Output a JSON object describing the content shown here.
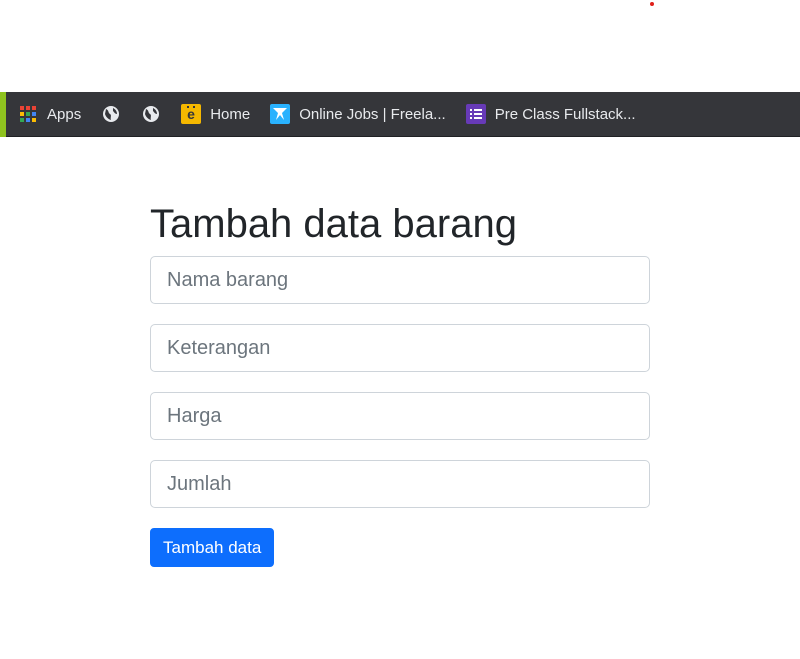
{
  "colors": {
    "bookmark_bar_bg": "#35363a",
    "bookmark_text": "#e8eaed",
    "accent_stripe": "#8fc31f",
    "primary_button": "#0d6efd",
    "input_border": "#ced4da",
    "placeholder": "#6c757d",
    "heading": "#212529"
  },
  "bookmarks": [
    {
      "label": "Apps",
      "icon": "apps-grid-icon"
    },
    {
      "label": "",
      "icon": "globe-icon"
    },
    {
      "label": "",
      "icon": "globe-icon"
    },
    {
      "label": "Home",
      "icon": "home-site-icon"
    },
    {
      "label": "Online Jobs | Freela...",
      "icon": "freelancer-icon"
    },
    {
      "label": "Pre Class Fullstack...",
      "icon": "list-form-icon"
    }
  ],
  "form": {
    "title": "Tambah data barang",
    "fields": [
      {
        "placeholder": "Nama barang",
        "value": ""
      },
      {
        "placeholder": "Keterangan",
        "value": ""
      },
      {
        "placeholder": "Harga",
        "value": ""
      },
      {
        "placeholder": "Jumlah",
        "value": ""
      }
    ],
    "submit_label": "Tambah data"
  }
}
